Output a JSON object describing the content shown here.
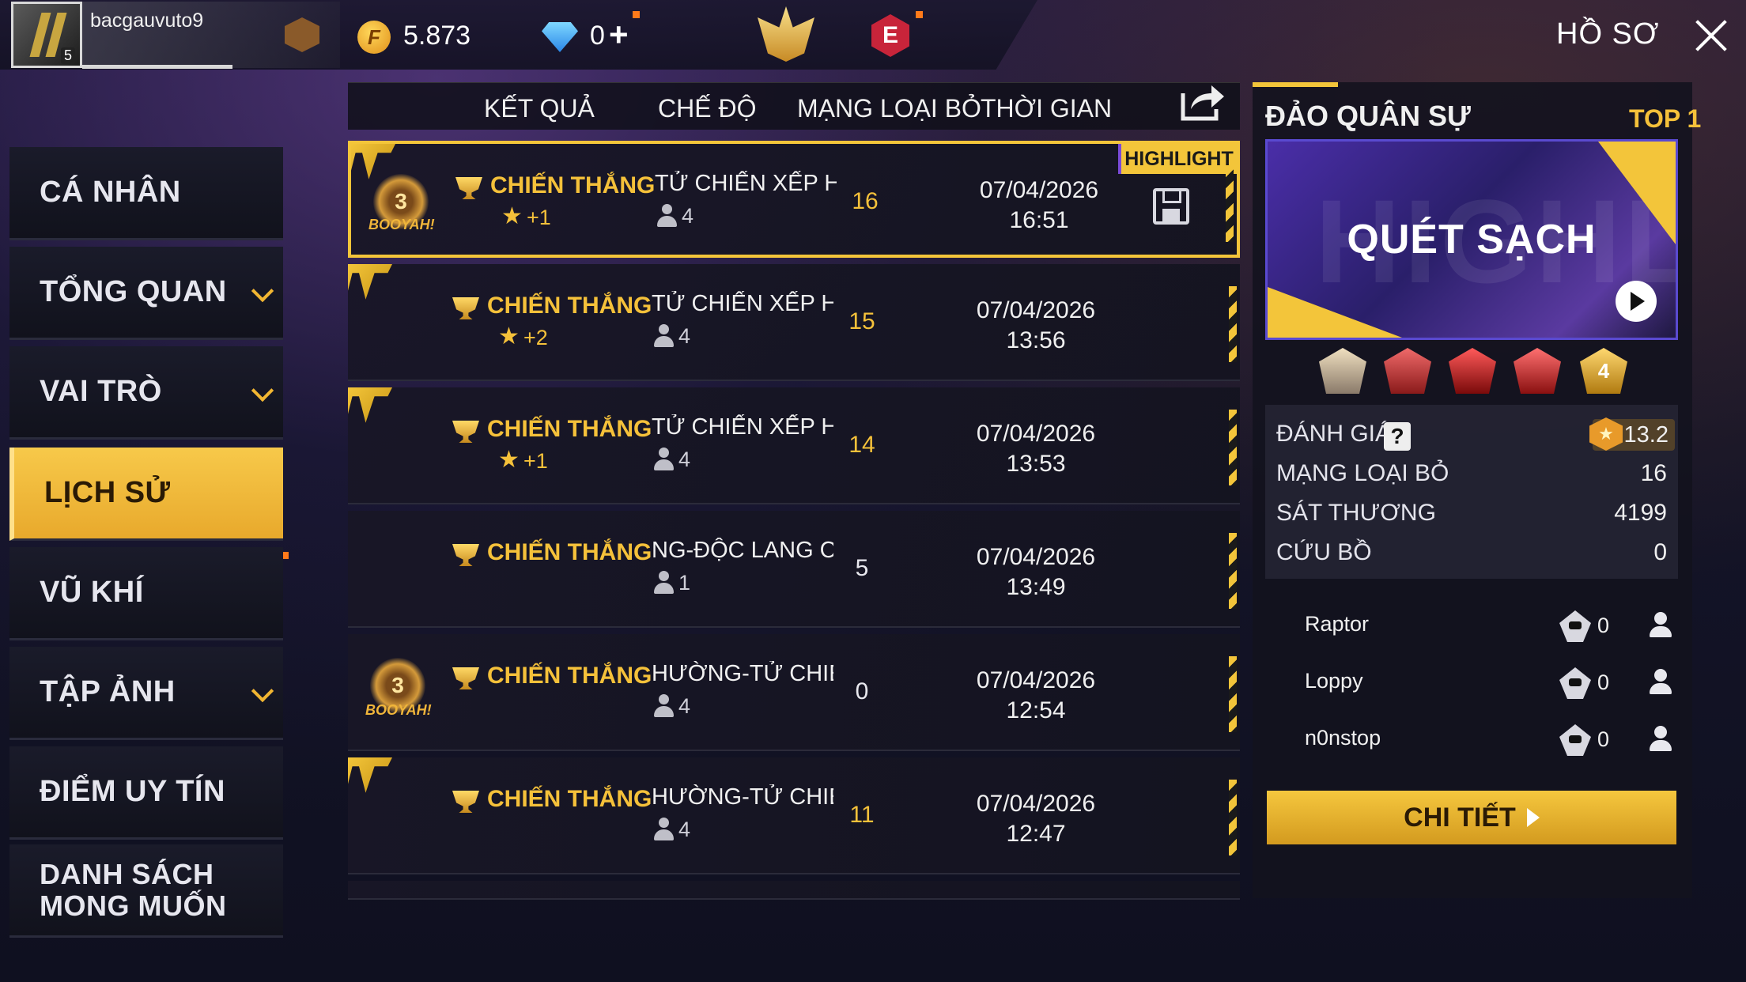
{
  "header": {
    "username": "bacgauvuto9",
    "avatar_level": "5",
    "rank_badge_letter": "",
    "coins": "5.873",
    "coin_symbol": "F",
    "diamonds": "0",
    "diamond_plus": "+",
    "e_badge": "E",
    "profile_title": "HỒ SƠ"
  },
  "sidebar": {
    "items": [
      {
        "label": "CÁ NHÂN",
        "has_chevron": false,
        "active": false
      },
      {
        "label": "TỔNG QUAN",
        "has_chevron": true,
        "active": false
      },
      {
        "label": "VAI TRÒ",
        "has_chevron": true,
        "active": false
      },
      {
        "label": "LỊCH SỬ",
        "has_chevron": false,
        "active": true
      },
      {
        "label": "VŨ KHÍ",
        "has_chevron": false,
        "active": false
      },
      {
        "label": "TẬP ẢNH",
        "has_chevron": true,
        "active": false
      },
      {
        "label": "ĐIỂM UY TÍN",
        "has_chevron": false,
        "active": false
      },
      {
        "label": "DANH SÁCH MONG MUỐN",
        "line1": "DANH SÁCH",
        "line2": "MONG MUỐN",
        "has_chevron": false,
        "active": false
      }
    ]
  },
  "table": {
    "headers": {
      "result": "KẾT QUẢ",
      "mode": "CHẾ ĐỘ",
      "kills": "MẠNG LOẠI BỎ",
      "time": "THỜI GIAN"
    },
    "highlight_tag": "HIGHLIGHT",
    "booyah_text": "BOOYAH!",
    "rows": [
      {
        "result": "CHIẾN THẮNG",
        "star": "★",
        "points": "+1",
        "mode": "TỬ CHIẾN XẾP HẠ",
        "players": "4",
        "kills": "16",
        "date": "07/04/2026",
        "time": "16:51",
        "booyah_rank": "3",
        "highlight": true
      },
      {
        "result": "CHIẾN THẮNG",
        "star": "★",
        "points": "+2",
        "mode": "TỬ CHIẾN XẾP HẠ",
        "players": "4",
        "kills": "15",
        "date": "07/04/2026",
        "time": "13:56",
        "booyah_rank": "",
        "highlight": false
      },
      {
        "result": "CHIẾN THẮNG",
        "star": "★",
        "points": "+1",
        "mode": "TỬ CHIẾN XẾP HẠ",
        "players": "4",
        "kills": "14",
        "date": "07/04/2026",
        "time": "13:53",
        "booyah_rank": "",
        "highlight": false
      },
      {
        "result": "CHIẾN THẮNG",
        "star": "",
        "points": "",
        "mode": "NG-ĐỘC LANG CHI",
        "players": "1",
        "kills": "5",
        "date": "07/04/2026",
        "time": "13:49",
        "booyah_rank": "",
        "highlight": false
      },
      {
        "result": "CHIẾN THẮNG",
        "star": "",
        "points": "",
        "mode": "HƯỜNG-TỬ CHIẾN",
        "players": "4",
        "kills": "0",
        "date": "07/04/2026",
        "time": "12:54",
        "booyah_rank": "3",
        "highlight": false
      },
      {
        "result": "CHIẾN THẮNG",
        "star": "",
        "points": "",
        "mode": "HƯỜNG-TỬ CHIẾN",
        "players": "4",
        "kills": "11",
        "date": "07/04/2026",
        "time": "12:47",
        "booyah_rank": "",
        "highlight": false
      }
    ]
  },
  "detail": {
    "map_name": "ĐẢO QUÂN SỰ",
    "placement": "TOP 1",
    "banner_title": "QUÉT SẠCH",
    "banner_ghost": "HIGHLIGHT",
    "medal_badge": "4",
    "rating_label": "ĐÁNH GIÁ",
    "rating_help": "?",
    "rating_value": "13.2",
    "stats": [
      {
        "label": "MẠNG LOẠI BỎ",
        "value": "16"
      },
      {
        "label": "SÁT THƯƠNG",
        "value": "4199"
      },
      {
        "label": "CỨU BỒ",
        "value": "0"
      }
    ],
    "teammates": [
      {
        "name": "Raptor",
        "kills": "0"
      },
      {
        "name": "Loppy",
        "kills": "0"
      },
      {
        "name": "n0nstop",
        "kills": "0"
      }
    ],
    "details_button": "CHI TIẾT"
  },
  "colors": {
    "accent_gold": "#f3c53a",
    "win_text": "#f5c13a",
    "panel_bg": "#12121e",
    "banner_purple": "#4a2ea8"
  },
  "icons": [
    "crown-icon",
    "e-badge-icon",
    "coin-icon",
    "diamond-icon",
    "close-icon",
    "share-icon",
    "save-icon",
    "trophy-icon",
    "person-icon",
    "skull-icon",
    "add-friend-icon",
    "play-icon"
  ]
}
